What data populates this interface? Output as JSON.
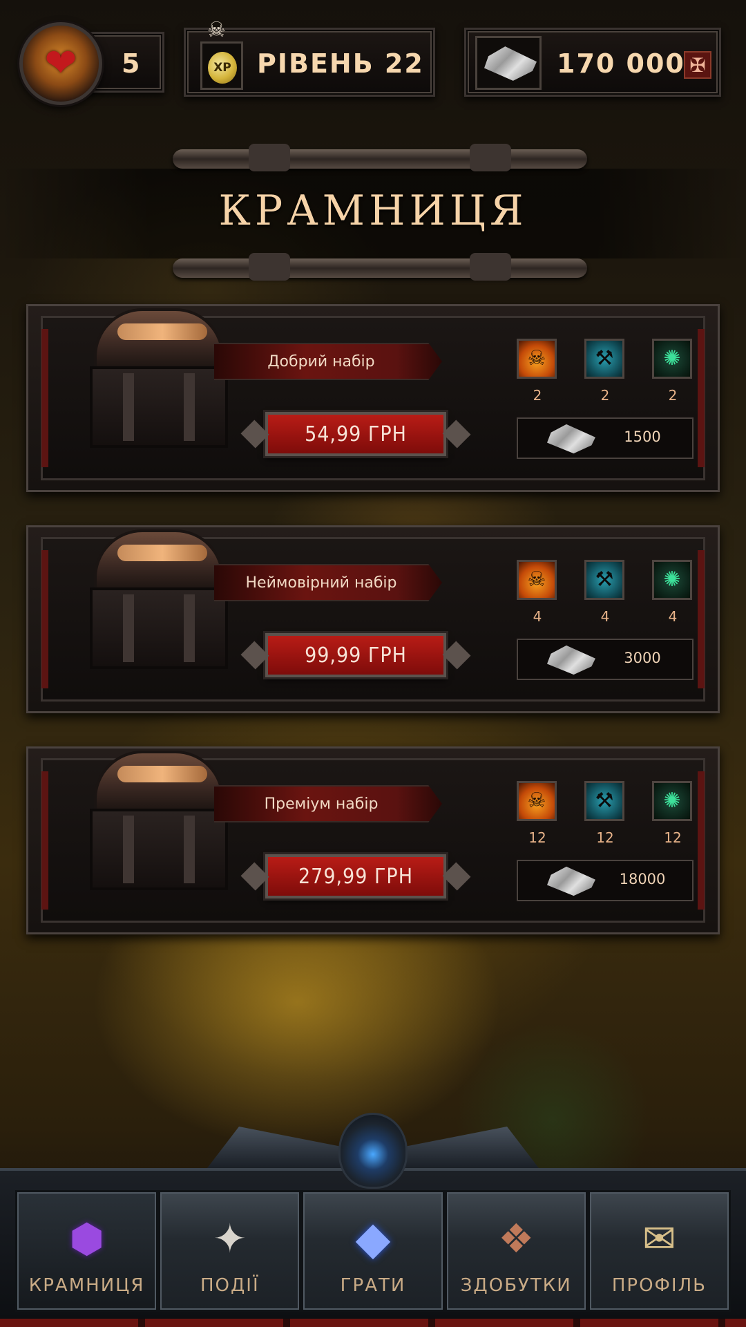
{
  "topbar": {
    "lives": "5",
    "level": "РІВЕНЬ 22",
    "xp_badge": "XP",
    "currency": "170 000",
    "add_currency_symbol": "✠"
  },
  "page": {
    "title": "КРАМНИЦЯ"
  },
  "offers": [
    {
      "name": "Добрий набір",
      "price": "54,99 ГРН",
      "rewards": [
        "2",
        "2",
        "2"
      ],
      "currency_amount": "1500"
    },
    {
      "name": "Неймовірний набір",
      "price": "99,99 ГРН",
      "rewards": [
        "4",
        "4",
        "4"
      ],
      "currency_amount": "3000"
    },
    {
      "name": "Преміум набір",
      "price": "279,99 ГРН",
      "rewards": [
        "12",
        "12",
        "12"
      ],
      "currency_amount": "18000"
    }
  ],
  "reward_icons": [
    "fire-skulls-icon",
    "hammer-icon",
    "tree-icon"
  ],
  "nav": {
    "tabs": [
      {
        "label": "КРАМНИЦЯ",
        "icon": "purple-gem-icon",
        "active": true
      },
      {
        "label": "ПОДІЇ",
        "icon": "compass-star-icon",
        "active": false
      },
      {
        "label": "ГРАТИ",
        "icon": "diamond-icon",
        "active": false
      },
      {
        "label": "ЗДОБУТКИ",
        "icon": "ornate-box-icon",
        "active": false
      },
      {
        "label": "ПРОФІЛЬ",
        "icon": "scroll-icon",
        "active": false
      }
    ]
  },
  "colors": {
    "accent_red": "#7e0c0a",
    "text_gold": "#f6d7ae",
    "nav_label": "#c9ab86"
  }
}
